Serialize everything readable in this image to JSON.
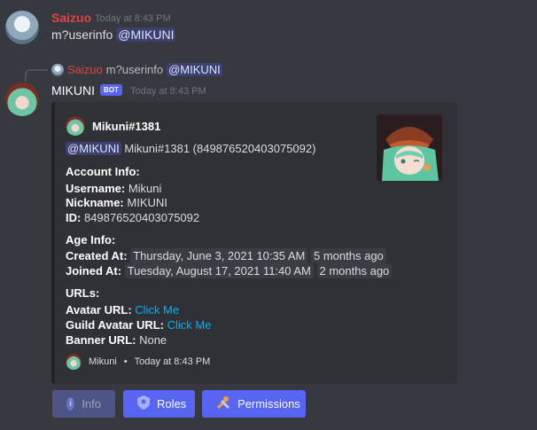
{
  "user_message": {
    "username": "Saizuo",
    "timestamp": "Today at 8:43 PM",
    "command": "m?userinfo",
    "mention": "@MIKUNI"
  },
  "reply_preview": {
    "username": "Saizuo",
    "command": "m?userinfo",
    "mention": "@MIKUNI"
  },
  "bot_message": {
    "username": "MIKUNI",
    "badge": "BOT",
    "timestamp": "Today at 8:43 PM"
  },
  "embed": {
    "author": "Mikuni#1381",
    "mention": "@MIKUNI",
    "tag_line": "Mikuni#1381 (849876520403075092)",
    "account_header": "Account Info:",
    "username_label": "Username:",
    "username_value": "Mikuni",
    "nickname_label": "Nickname:",
    "nickname_value": "MIKUNI",
    "id_label": "ID:",
    "id_value": "849876520403075092",
    "age_header": "Age Info:",
    "created_label": "Created At:",
    "created_value": "Thursday, June 3, 2021 10:35 AM",
    "created_rel": "5 months ago",
    "joined_label": "Joined At:",
    "joined_value": "Tuesday, August 17, 2021 11:40 AM",
    "joined_rel": "2 months ago",
    "urls_header": "URLs:",
    "avatar_label": "Avatar URL:",
    "avatar_link": "Click Me",
    "guild_avatar_label": "Guild Avatar URL:",
    "guild_avatar_link": "Click Me",
    "banner_label": "Banner URL:",
    "banner_value": "None",
    "footer_name": "Mikuni",
    "footer_sep": "•",
    "footer_time": "Today at 8:43 PM"
  },
  "buttons": {
    "info": "Info",
    "roles": "Roles",
    "permissions": "Permissions"
  }
}
